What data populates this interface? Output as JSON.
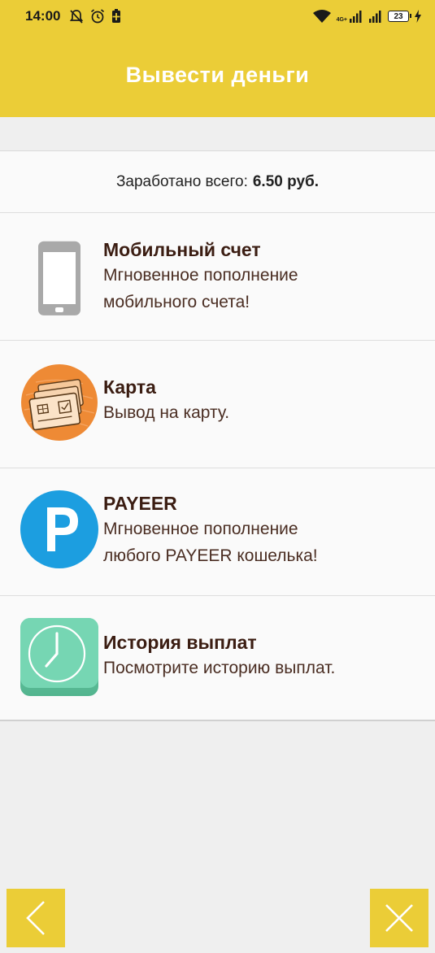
{
  "status_bar": {
    "time": "14:00",
    "network": "4G+",
    "battery": "23"
  },
  "header": {
    "title": "Вывести деньги"
  },
  "total": {
    "label": "Заработано всего:",
    "value": "6.50 руб."
  },
  "items": [
    {
      "title": "Мобильный счет",
      "desc1": "Мгновенное пополнение",
      "desc2": "мобильного счета!",
      "icon": "phone-icon"
    },
    {
      "title": "Карта",
      "desc1": "Вывод на карту.",
      "icon": "card-icon"
    },
    {
      "title": "PAYEER",
      "desc1": "Мгновенное пополнение",
      "desc2": "любого PAYEER кошелька!",
      "icon": "payeer-icon"
    },
    {
      "title": "История выплат",
      "desc1": "Посмотрите историю выплат.",
      "icon": "clock-icon"
    }
  ],
  "colors": {
    "accent": "#ebcd37",
    "background": "#efefef",
    "card_orange": "#ee8a35",
    "payeer_blue": "#1c9ee0",
    "history_green": "#6fd4b0"
  }
}
